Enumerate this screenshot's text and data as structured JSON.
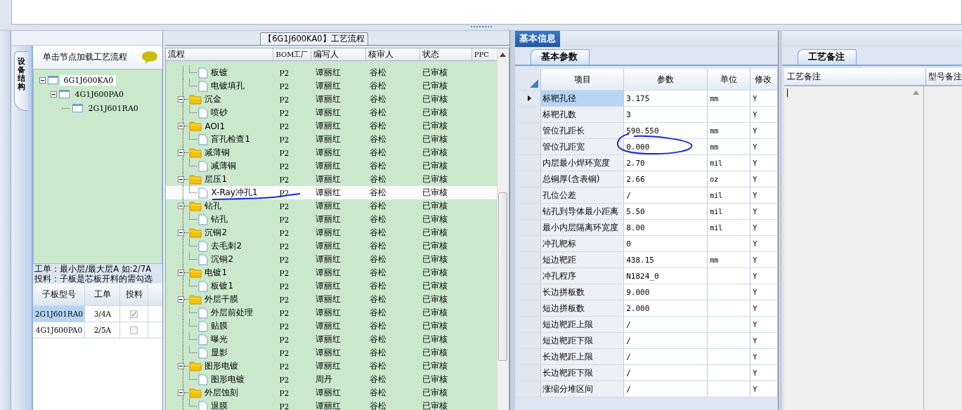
{
  "device_panel": {
    "side_tab": "设备结构",
    "hint": "单击节点加载工艺流程",
    "tree": [
      {
        "label": "6G1J600KA0",
        "selected": true,
        "expanded": true,
        "children": [
          {
            "label": "4G1J600PA0",
            "selected": false,
            "expanded": true,
            "children": [
              {
                "label": "2G1J601RA0",
                "selected": false
              }
            ]
          }
        ]
      }
    ],
    "notes": [
      "工单：最小层/最大层A 如:2/7A",
      "投料：子板是芯板开料的需勾选"
    ],
    "table": {
      "columns": [
        "子板型号",
        "工单",
        "投料"
      ],
      "rows": [
        {
          "board": "2G1J601RA0",
          "order": "3/4A",
          "checked": true,
          "selected": true
        },
        {
          "board": "4G1J600PA0",
          "order": "2/5A",
          "checked": false,
          "selected": false
        }
      ]
    }
  },
  "flow_panel": {
    "title": "【6G1J600KA0】工艺流程",
    "columns": [
      "流程",
      "BOM工厂",
      "编写人",
      "核审人",
      "状态",
      "PPC"
    ],
    "groups": [
      {
        "children": [
          {
            "name": "板镀",
            "bom": "P2",
            "writer": "谭丽红",
            "reviewer": "谷松",
            "status": "已审核",
            "selected": false
          },
          {
            "name": "电镀填孔",
            "bom": "P2",
            "writer": "谭丽红",
            "reviewer": "谷松",
            "status": "已审核",
            "selected": false
          }
        ]
      },
      {
        "name": "沉金",
        "bom": "P2",
        "writer": "谭丽红",
        "reviewer": "谷松",
        "status": "已审核",
        "selected": false,
        "children": [
          {
            "name": "喷砂",
            "bom": "P2",
            "writer": "谭丽红",
            "reviewer": "谷松",
            "status": "已审核",
            "selected": false
          }
        ]
      },
      {
        "name": "AOI1",
        "bom": "P2",
        "writer": "谭丽红",
        "reviewer": "谷松",
        "status": "已审核",
        "selected": false,
        "children": [
          {
            "name": "盲孔检查1",
            "bom": "P2",
            "writer": "谭丽红",
            "reviewer": "谷松",
            "status": "已审核",
            "selected": false
          }
        ]
      },
      {
        "name": "减薄铜",
        "bom": "P2",
        "writer": "谭丽红",
        "reviewer": "谷松",
        "status": "已审核",
        "selected": false,
        "children": [
          {
            "name": "减薄铜",
            "bom": "P2",
            "writer": "谭丽红",
            "reviewer": "谷松",
            "status": "已审核",
            "selected": false
          }
        ]
      },
      {
        "name": "层压1",
        "bom": "P2",
        "writer": "谭丽红",
        "reviewer": "谷松",
        "status": "已审核",
        "selected": false,
        "children": [
          {
            "name": "X-Ray冲孔1",
            "bom": "P2",
            "writer": "谭丽红",
            "reviewer": "谷松",
            "status": "已审核",
            "selected": true
          }
        ]
      },
      {
        "name": "钻孔",
        "bom": "P2",
        "writer": "谭丽红",
        "reviewer": "谷松",
        "status": "已审核",
        "selected": false,
        "children": [
          {
            "name": "钻孔",
            "bom": "P2",
            "writer": "谭丽红",
            "reviewer": "谷松",
            "status": "已审核",
            "selected": false
          }
        ]
      },
      {
        "name": "沉铜2",
        "bom": "P2",
        "writer": "谭丽红",
        "reviewer": "谷松",
        "status": "已审核",
        "selected": false,
        "children": [
          {
            "name": "去毛刺2",
            "bom": "P2",
            "writer": "谭丽红",
            "reviewer": "谷松",
            "status": "已审核",
            "selected": false
          },
          {
            "name": "沉铜2",
            "bom": "P2",
            "writer": "谭丽红",
            "reviewer": "谷松",
            "status": "已审核",
            "selected": false
          }
        ]
      },
      {
        "name": "电镀1",
        "bom": "P2",
        "writer": "谭丽红",
        "reviewer": "谷松",
        "status": "已审核",
        "selected": false,
        "children": [
          {
            "name": "板镀1",
            "bom": "P2",
            "writer": "谭丽红",
            "reviewer": "谷松",
            "status": "已审核",
            "selected": false
          }
        ]
      },
      {
        "name": "外层干膜",
        "bom": "P2",
        "writer": "谭丽红",
        "reviewer": "谷松",
        "status": "已审核",
        "selected": false,
        "children": [
          {
            "name": "外层前处理",
            "bom": "P2",
            "writer": "谭丽红",
            "reviewer": "谷松",
            "status": "已审核",
            "selected": false
          },
          {
            "name": "贴膜",
            "bom": "P2",
            "writer": "谭丽红",
            "reviewer": "谷松",
            "status": "已审核",
            "selected": false
          },
          {
            "name": "曝光",
            "bom": "P2",
            "writer": "谭丽红",
            "reviewer": "谷松",
            "status": "已审核",
            "selected": false
          },
          {
            "name": "显影",
            "bom": "P2",
            "writer": "谭丽红",
            "reviewer": "谷松",
            "status": "已审核",
            "selected": false
          }
        ]
      },
      {
        "name": "图形电镀",
        "bom": "P2",
        "writer": "谭丽红",
        "reviewer": "谷松",
        "status": "已审核",
        "selected": false,
        "children": [
          {
            "name": "图形电镀",
            "bom": "P2",
            "writer": "周丹",
            "reviewer": "谷松",
            "status": "已审核",
            "selected": false
          }
        ]
      },
      {
        "name": "外层蚀刻",
        "bom": "P2",
        "writer": "谭丽红",
        "reviewer": "谷松",
        "status": "已审核",
        "selected": false,
        "children": [
          {
            "name": "退膜",
            "bom": "P2",
            "writer": "谭丽红",
            "reviewer": "谷松",
            "status": "已审核",
            "selected": false
          }
        ]
      }
    ]
  },
  "info_panel": {
    "tab": "基本信息",
    "subtab": "基本参数",
    "columns": [
      "项目",
      "参数",
      "单位",
      "修改"
    ],
    "rows": [
      {
        "item": "标靶孔径",
        "value": "3.175",
        "unit": "mm",
        "edit": "Y",
        "selected": true
      },
      {
        "item": "标靶孔数",
        "value": "3",
        "edit": "Y",
        "selected": false
      },
      {
        "item": "管位孔距长",
        "value": "590.550",
        "unit": "mm",
        "edit": "Y",
        "selected": false
      },
      {
        "item": "管位孔距宽",
        "value": "0.000",
        "unit": "mm",
        "edit": "Y",
        "selected": false
      },
      {
        "item": "内层最小焊环宽度",
        "value": "2.70",
        "unit": "mil",
        "edit": "Y",
        "selected": false
      },
      {
        "item": "总铜厚(含表铜)",
        "value": "2.66",
        "unit": "oz",
        "edit": "Y",
        "selected": false
      },
      {
        "item": "孔位公差",
        "value": "/",
        "unit": "mil",
        "edit": "Y",
        "selected": false
      },
      {
        "item": "钻孔到导体最小距离",
        "value": "5.50",
        "unit": "mil",
        "edit": "Y",
        "selected": false
      },
      {
        "item": "最小内层隔离环宽度",
        "value": "8.00",
        "unit": "mil",
        "edit": "Y",
        "selected": false
      },
      {
        "item": "冲孔靶标",
        "value": "0",
        "edit": "Y",
        "selected": false
      },
      {
        "item": "短边靶距",
        "value": "438.15",
        "unit": "mm",
        "edit": "Y",
        "selected": false
      },
      {
        "item": "冲孔程序",
        "value": "N1824_0",
        "edit": "Y",
        "selected": false
      },
      {
        "item": "长边拼板数",
        "value": "9.000",
        "edit": "Y",
        "selected": false
      },
      {
        "item": "短边拼板数",
        "value": "2.000",
        "edit": "Y",
        "selected": false
      },
      {
        "item": "短边靶距上限",
        "value": "/",
        "edit": "Y",
        "selected": false
      },
      {
        "item": "短边靶距下限",
        "value": "/",
        "edit": "Y",
        "selected": false
      },
      {
        "item": "长边靶距上限",
        "value": "/",
        "edit": "Y",
        "selected": false
      },
      {
        "item": "长边靶距下限",
        "value": "/",
        "edit": "Y",
        "selected": false
      },
      {
        "item": "涨缩分堆区间",
        "value": "/",
        "edit": "Y",
        "selected": false
      }
    ]
  },
  "remarks_panel": {
    "tab": "工艺备注",
    "columns": [
      "工艺备注",
      "型号备注"
    ]
  }
}
